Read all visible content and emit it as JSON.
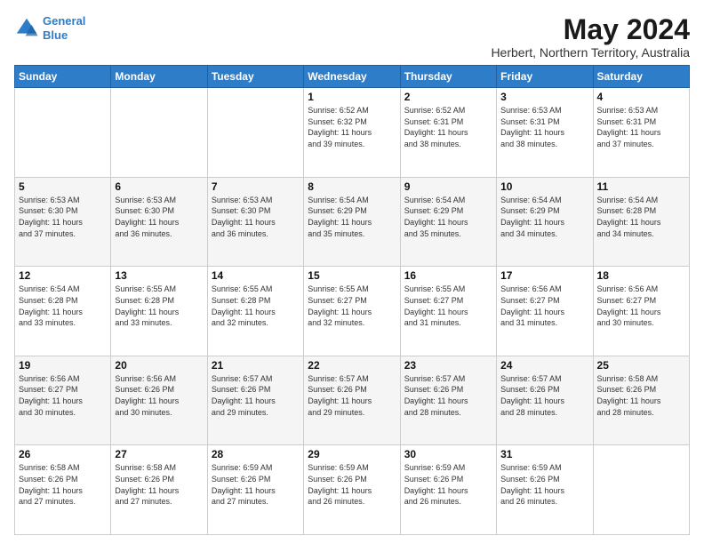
{
  "header": {
    "logo_line1": "General",
    "logo_line2": "Blue",
    "main_title": "May 2024",
    "subtitle": "Herbert, Northern Territory, Australia"
  },
  "days_of_week": [
    "Sunday",
    "Monday",
    "Tuesday",
    "Wednesday",
    "Thursday",
    "Friday",
    "Saturday"
  ],
  "weeks": [
    [
      {
        "day": "",
        "info": ""
      },
      {
        "day": "",
        "info": ""
      },
      {
        "day": "",
        "info": ""
      },
      {
        "day": "1",
        "info": "Sunrise: 6:52 AM\nSunset: 6:32 PM\nDaylight: 11 hours\nand 39 minutes."
      },
      {
        "day": "2",
        "info": "Sunrise: 6:52 AM\nSunset: 6:31 PM\nDaylight: 11 hours\nand 38 minutes."
      },
      {
        "day": "3",
        "info": "Sunrise: 6:53 AM\nSunset: 6:31 PM\nDaylight: 11 hours\nand 38 minutes."
      },
      {
        "day": "4",
        "info": "Sunrise: 6:53 AM\nSunset: 6:31 PM\nDaylight: 11 hours\nand 37 minutes."
      }
    ],
    [
      {
        "day": "5",
        "info": "Sunrise: 6:53 AM\nSunset: 6:30 PM\nDaylight: 11 hours\nand 37 minutes."
      },
      {
        "day": "6",
        "info": "Sunrise: 6:53 AM\nSunset: 6:30 PM\nDaylight: 11 hours\nand 36 minutes."
      },
      {
        "day": "7",
        "info": "Sunrise: 6:53 AM\nSunset: 6:30 PM\nDaylight: 11 hours\nand 36 minutes."
      },
      {
        "day": "8",
        "info": "Sunrise: 6:54 AM\nSunset: 6:29 PM\nDaylight: 11 hours\nand 35 minutes."
      },
      {
        "day": "9",
        "info": "Sunrise: 6:54 AM\nSunset: 6:29 PM\nDaylight: 11 hours\nand 35 minutes."
      },
      {
        "day": "10",
        "info": "Sunrise: 6:54 AM\nSunset: 6:29 PM\nDaylight: 11 hours\nand 34 minutes."
      },
      {
        "day": "11",
        "info": "Sunrise: 6:54 AM\nSunset: 6:28 PM\nDaylight: 11 hours\nand 34 minutes."
      }
    ],
    [
      {
        "day": "12",
        "info": "Sunrise: 6:54 AM\nSunset: 6:28 PM\nDaylight: 11 hours\nand 33 minutes."
      },
      {
        "day": "13",
        "info": "Sunrise: 6:55 AM\nSunset: 6:28 PM\nDaylight: 11 hours\nand 33 minutes."
      },
      {
        "day": "14",
        "info": "Sunrise: 6:55 AM\nSunset: 6:28 PM\nDaylight: 11 hours\nand 32 minutes."
      },
      {
        "day": "15",
        "info": "Sunrise: 6:55 AM\nSunset: 6:27 PM\nDaylight: 11 hours\nand 32 minutes."
      },
      {
        "day": "16",
        "info": "Sunrise: 6:55 AM\nSunset: 6:27 PM\nDaylight: 11 hours\nand 31 minutes."
      },
      {
        "day": "17",
        "info": "Sunrise: 6:56 AM\nSunset: 6:27 PM\nDaylight: 11 hours\nand 31 minutes."
      },
      {
        "day": "18",
        "info": "Sunrise: 6:56 AM\nSunset: 6:27 PM\nDaylight: 11 hours\nand 30 minutes."
      }
    ],
    [
      {
        "day": "19",
        "info": "Sunrise: 6:56 AM\nSunset: 6:27 PM\nDaylight: 11 hours\nand 30 minutes."
      },
      {
        "day": "20",
        "info": "Sunrise: 6:56 AM\nSunset: 6:26 PM\nDaylight: 11 hours\nand 30 minutes."
      },
      {
        "day": "21",
        "info": "Sunrise: 6:57 AM\nSunset: 6:26 PM\nDaylight: 11 hours\nand 29 minutes."
      },
      {
        "day": "22",
        "info": "Sunrise: 6:57 AM\nSunset: 6:26 PM\nDaylight: 11 hours\nand 29 minutes."
      },
      {
        "day": "23",
        "info": "Sunrise: 6:57 AM\nSunset: 6:26 PM\nDaylight: 11 hours\nand 28 minutes."
      },
      {
        "day": "24",
        "info": "Sunrise: 6:57 AM\nSunset: 6:26 PM\nDaylight: 11 hours\nand 28 minutes."
      },
      {
        "day": "25",
        "info": "Sunrise: 6:58 AM\nSunset: 6:26 PM\nDaylight: 11 hours\nand 28 minutes."
      }
    ],
    [
      {
        "day": "26",
        "info": "Sunrise: 6:58 AM\nSunset: 6:26 PM\nDaylight: 11 hours\nand 27 minutes."
      },
      {
        "day": "27",
        "info": "Sunrise: 6:58 AM\nSunset: 6:26 PM\nDaylight: 11 hours\nand 27 minutes."
      },
      {
        "day": "28",
        "info": "Sunrise: 6:59 AM\nSunset: 6:26 PM\nDaylight: 11 hours\nand 27 minutes."
      },
      {
        "day": "29",
        "info": "Sunrise: 6:59 AM\nSunset: 6:26 PM\nDaylight: 11 hours\nand 26 minutes."
      },
      {
        "day": "30",
        "info": "Sunrise: 6:59 AM\nSunset: 6:26 PM\nDaylight: 11 hours\nand 26 minutes."
      },
      {
        "day": "31",
        "info": "Sunrise: 6:59 AM\nSunset: 6:26 PM\nDaylight: 11 hours\nand 26 minutes."
      },
      {
        "day": "",
        "info": ""
      }
    ]
  ]
}
